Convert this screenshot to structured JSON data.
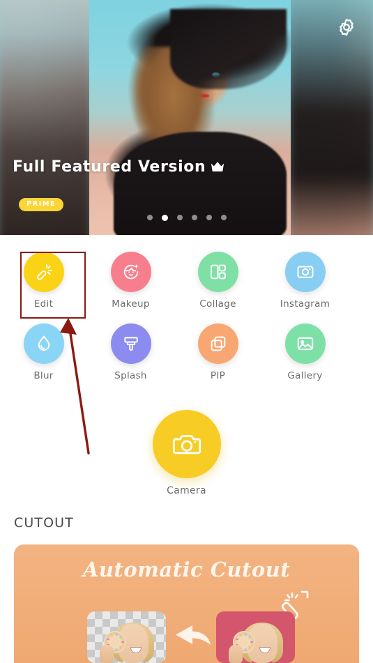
{
  "banner": {
    "title": "Full Featured Version",
    "crown_icon": "crown-icon",
    "badge": "PRIME",
    "settings_icon": "gear-icon",
    "dot_count": 6,
    "active_dot_index": 1
  },
  "tools": {
    "row1": [
      {
        "label": "Edit",
        "icon": "magic-wand-icon",
        "color": "#FBD316"
      },
      {
        "label": "Makeup",
        "icon": "face-sparkle-icon",
        "color": "#F77F8D"
      },
      {
        "label": "Collage",
        "icon": "grid-layout-icon",
        "color": "#7EE0A4"
      },
      {
        "label": "Instagram",
        "icon": "instagram-camera-icon",
        "color": "#87CEF2"
      }
    ],
    "row2": [
      {
        "label": "Blur",
        "icon": "water-drop-icon",
        "color": "#8AD4F5"
      },
      {
        "label": "Splash",
        "icon": "paint-brush-icon",
        "color": "#8C8CF0"
      },
      {
        "label": "PIP",
        "icon": "stacked-squares-icon",
        "color": "#F8A772"
      },
      {
        "label": "Gallery",
        "icon": "photo-image-icon",
        "color": "#7DE0A6"
      }
    ],
    "camera": {
      "label": "Camera",
      "icon": "camera-icon",
      "color": "#F7CC24"
    }
  },
  "cutout": {
    "heading": "CUTOUT",
    "card_title": "Automatic Cutout",
    "card_icon": "cutout-wand-icon",
    "card_color": "#EFA871",
    "thumb_right_color": "#D4566C",
    "arrow_icon": "arrow-left-icon"
  },
  "annotation": {
    "highlight_target": "Edit",
    "color": "#8C1A12"
  }
}
